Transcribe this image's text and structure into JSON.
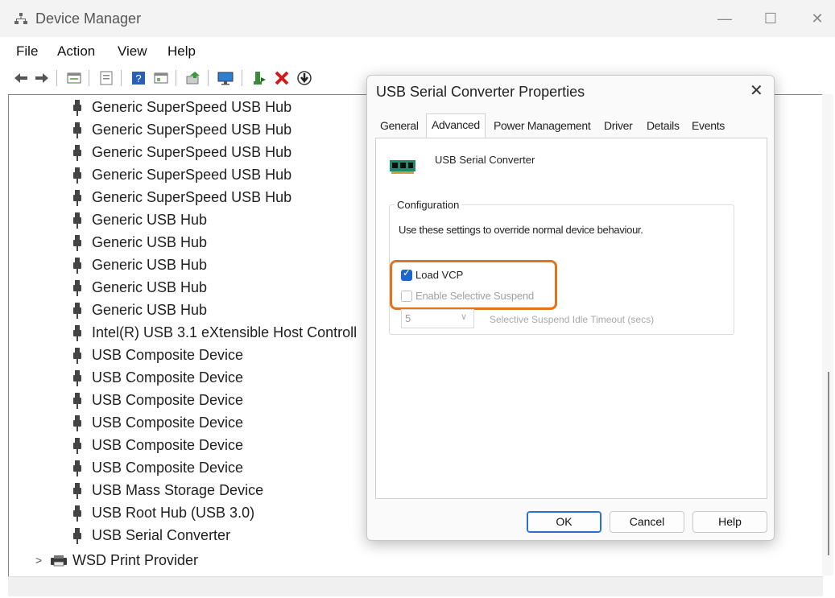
{
  "window": {
    "title": "Device Manager",
    "controls": {
      "minimize": "—",
      "maximize": "☐",
      "close": "✕"
    }
  },
  "menu": [
    "File",
    "Action",
    "View",
    "Help"
  ],
  "toolbar_icons": [
    "back-icon",
    "forward-icon",
    "properties-icon",
    "show-hidden-icon",
    "help-icon",
    "view-icon",
    "update-driver-icon",
    "monitor-icon",
    "enable-device-icon",
    "uninstall-icon",
    "scan-icon"
  ],
  "tree": {
    "items": [
      "Generic SuperSpeed USB Hub",
      "Generic SuperSpeed USB Hub",
      "Generic SuperSpeed USB Hub",
      "Generic SuperSpeed USB Hub",
      "Generic SuperSpeed USB Hub",
      "Generic USB Hub",
      "Generic USB Hub",
      "Generic USB Hub",
      "Generic USB Hub",
      "Generic USB Hub",
      "Intel(R) USB 3.1 eXtensible Host Controll",
      "USB Composite Device",
      "USB Composite Device",
      "USB Composite Device",
      "USB Composite Device",
      "USB Composite Device",
      "USB Composite Device",
      "USB Mass Storage Device",
      "USB Root Hub (USB 3.0)",
      "USB Serial Converter"
    ],
    "category": {
      "expander": ">",
      "label": "WSD Print Provider"
    }
  },
  "dialog": {
    "title": "USB Serial Converter Properties",
    "close": "✕",
    "tabs": [
      "General",
      "Advanced",
      "Power Management",
      "Driver",
      "Details",
      "Events"
    ],
    "active_tab": "Advanced",
    "device_name": "USB Serial Converter",
    "group_title": "Configuration",
    "description": "Use these settings to override normal device behaviour.",
    "load_vcp": {
      "label": "Load VCP",
      "checked": true
    },
    "selective_suspend": {
      "label": "Enable Selective Suspend",
      "checked": false,
      "enabled": false
    },
    "timeout": {
      "value": "5",
      "label": "Selective Suspend Idle Timeout (secs)",
      "enabled": false
    },
    "buttons": {
      "ok": "OK",
      "cancel": "Cancel",
      "help": "Help"
    }
  },
  "colors": {
    "accent": "#1e66c7",
    "highlight": "#e3731d",
    "delete_red": "#d11a1a"
  }
}
